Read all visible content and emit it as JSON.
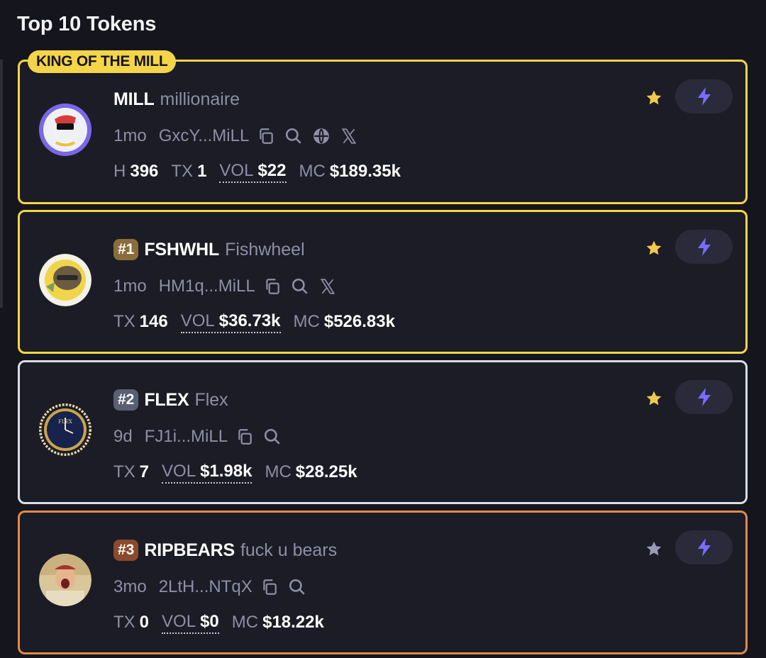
{
  "header": {
    "title": "Top 10 Tokens"
  },
  "king_badge": "KING OF THE MILL",
  "colors": {
    "gold": "#f5d547",
    "silver": "#d8dde6",
    "bronze": "#e08a4a",
    "star_active": "#f2c94c",
    "star_inactive": "#9a9ab5",
    "bolt": "#7b6cff"
  },
  "tokens": [
    {
      "ticker": "MILL",
      "name": "millionaire",
      "age": "1mo",
      "address": "GxcY...MiLL",
      "icons": [
        "copy-icon",
        "search-icon",
        "globe-icon",
        "x-icon"
      ],
      "stats": {
        "h_label": "H",
        "h_value": "396",
        "tx_label": "TX",
        "tx_value": "1",
        "vol_label": "VOL",
        "vol_value": "$22",
        "mc_label": "MC",
        "mc_value": "$189.35k"
      },
      "starred": true
    },
    {
      "rank": "#1",
      "ticker": "FSHWHL",
      "name": "Fishwheel",
      "age": "1mo",
      "address": "HM1q...MiLL",
      "icons": [
        "copy-icon",
        "search-icon",
        "x-icon"
      ],
      "stats": {
        "tx_label": "TX",
        "tx_value": "146",
        "vol_label": "VOL",
        "vol_value": "$36.73k",
        "mc_label": "MC",
        "mc_value": "$526.83k"
      },
      "starred": true
    },
    {
      "rank": "#2",
      "ticker": "FLEX",
      "name": "Flex",
      "age": "9d",
      "address": "FJ1i...MiLL",
      "icons": [
        "copy-icon",
        "search-icon"
      ],
      "stats": {
        "tx_label": "TX",
        "tx_value": "7",
        "vol_label": "VOL",
        "vol_value": "$1.98k",
        "mc_label": "MC",
        "mc_value": "$28.25k"
      },
      "starred": true
    },
    {
      "rank": "#3",
      "ticker": "RIPBEARS",
      "name": "fuck u bears",
      "age": "3mo",
      "address": "2LtH...NTqX",
      "icons": [
        "copy-icon",
        "search-icon"
      ],
      "stats": {
        "tx_label": "TX",
        "tx_value": "0",
        "vol_label": "VOL",
        "vol_value": "$0",
        "mc_label": "MC",
        "mc_value": "$18.22k"
      },
      "starred": false
    }
  ]
}
